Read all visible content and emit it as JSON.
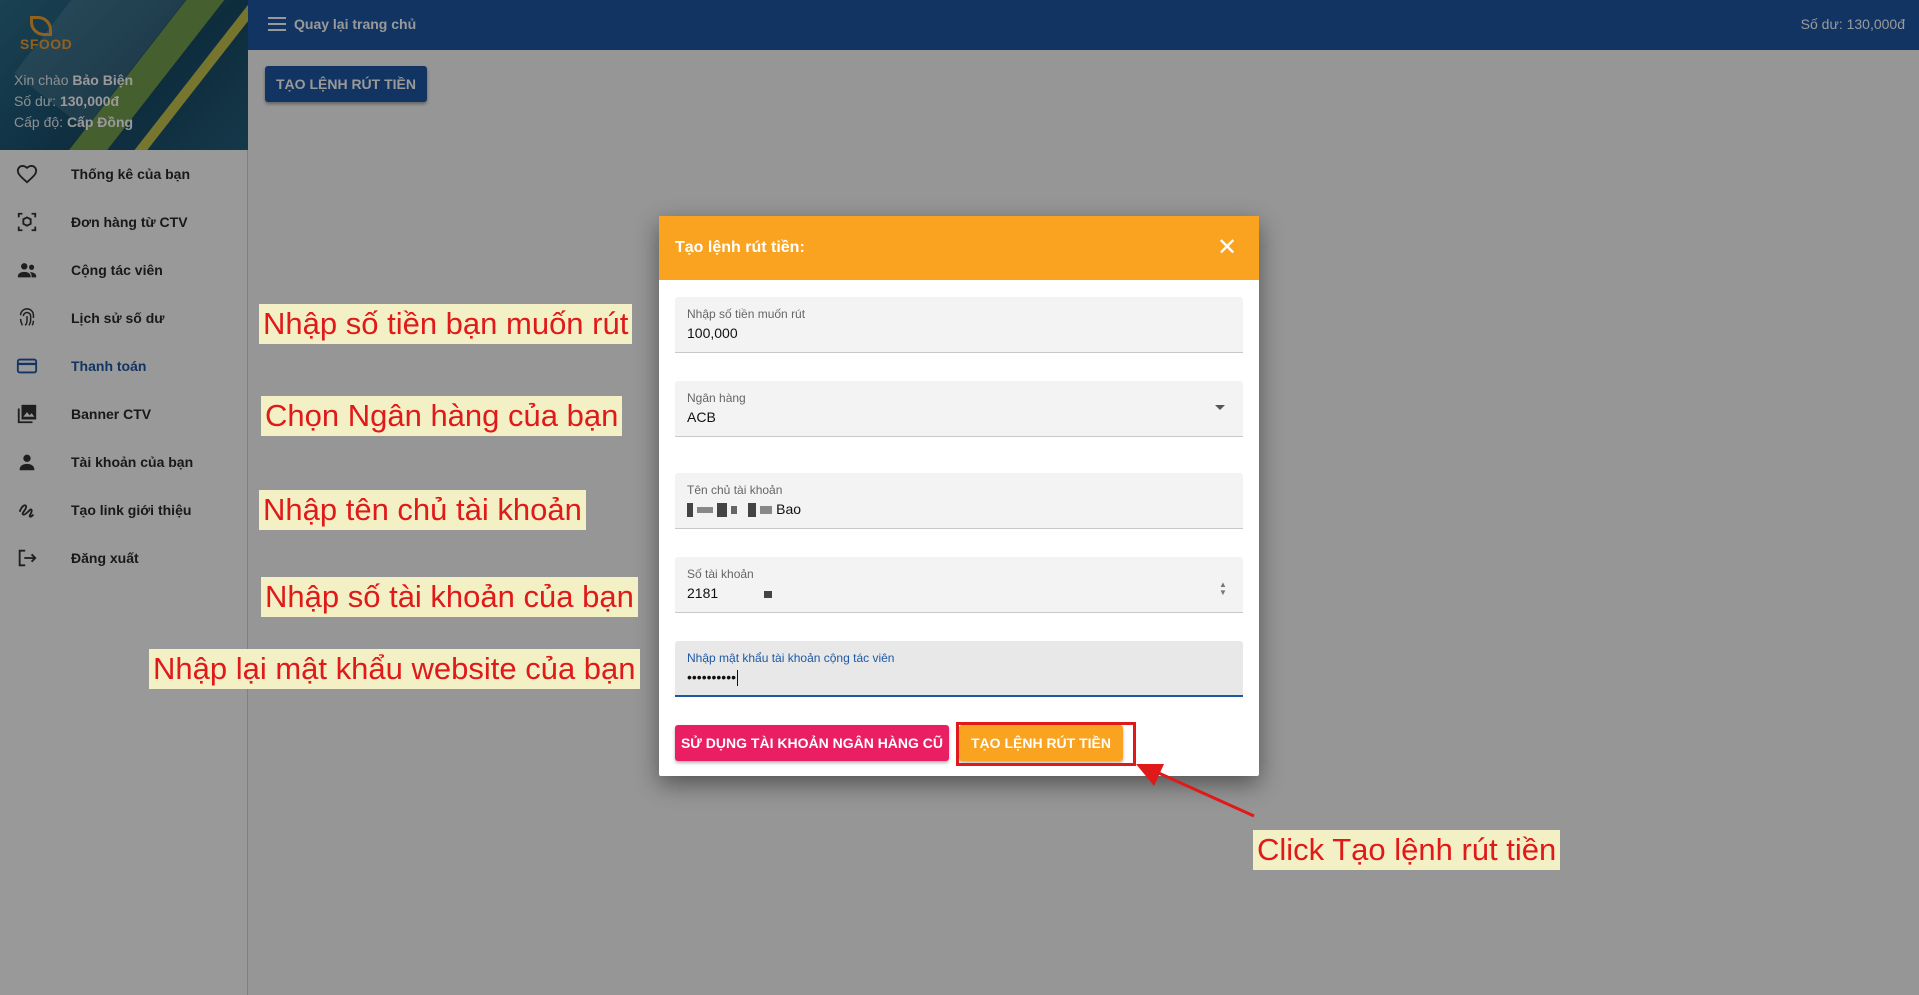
{
  "sidebar": {
    "logo_text": "SFOOD",
    "greeting_prefix": "Xin chào",
    "user_name": "Bảo Biện",
    "balance_prefix": "Số dư:",
    "balance": "130,000đ",
    "level_prefix": "Cấp độ:",
    "level": "Cấp Đồng",
    "items": [
      {
        "label": "Thống kê của bạn",
        "icon": "heart-icon"
      },
      {
        "label": "Đơn hàng từ CTV",
        "icon": "package-scan-icon"
      },
      {
        "label": "Cộng tác viên",
        "icon": "people-icon"
      },
      {
        "label": "Lịch sử số dư",
        "icon": "fingerprint-icon"
      },
      {
        "label": "Thanh toán",
        "icon": "credit-card-icon",
        "active": true
      },
      {
        "label": "Banner CTV",
        "icon": "photo-library-icon"
      },
      {
        "label": "Tài khoản của bạn",
        "icon": "person-icon"
      },
      {
        "label": "Tạo link giới thiệu",
        "icon": "link-squiggle-icon"
      },
      {
        "label": "Đăng xuất",
        "icon": "logout-icon"
      }
    ]
  },
  "topbar": {
    "back_label": "Quay lại trang chủ",
    "balance_text": "Số dư: 130,000đ"
  },
  "main": {
    "create_button_label": "TẠO LỆNH RÚT TIỀN"
  },
  "dialog": {
    "title": "Tạo lệnh rút tiền:",
    "close_icon": "close-icon",
    "fields": {
      "amount": {
        "label": "Nhập số tiền muốn rút",
        "value": "100,000"
      },
      "bank": {
        "label": "Ngân hàng",
        "value": "ACB"
      },
      "account_name": {
        "label": "Tên chủ tài khoản",
        "value": "Bao"
      },
      "account_number": {
        "label": "Số tài khoản",
        "value": "2181"
      },
      "password": {
        "label": "Nhập mật khẩu tài khoản cộng tác viên",
        "value": "••••••••••"
      }
    },
    "use_old_account_label": "SỬ DỤNG TÀI KHOẢN NGÂN HÀNG CŨ",
    "create_label": "TẠO LỆNH RÚT TIỀN"
  },
  "annotations": {
    "amount": "Nhập số tiền bạn muốn rút",
    "bank": "Chọn Ngân hàng của bạn",
    "account_name": "Nhập tên chủ tài khoản",
    "account_number": "Nhập số tài khoản của bạn",
    "password": "Nhập lại mật khẩu website của bạn",
    "click": "Click Tạo lệnh rút tiền"
  },
  "colors": {
    "primary": "#1d58a6",
    "dialog_header": "#f9a320",
    "secondary_button": "#e91e63",
    "annotation_text": "#e01919",
    "annotation_bg": "#f3f0c6"
  }
}
